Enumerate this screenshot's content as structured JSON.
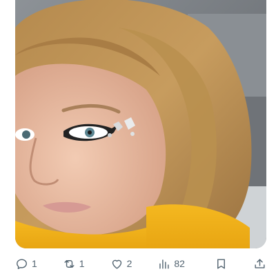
{
  "post": {
    "media": {
      "alt_icon": "photo-icon"
    },
    "actions": {
      "reply": {
        "icon": "reply-icon",
        "count": "1"
      },
      "repost": {
        "icon": "repost-icon",
        "count": "1"
      },
      "like": {
        "icon": "heart-icon",
        "count": "2"
      },
      "views": {
        "icon": "analytics-icon",
        "count": "82"
      },
      "bookmark": {
        "icon": "bookmark-icon"
      },
      "share": {
        "icon": "share-icon"
      }
    }
  },
  "colors": {
    "icon": "#536471",
    "background": "#ffffff"
  }
}
